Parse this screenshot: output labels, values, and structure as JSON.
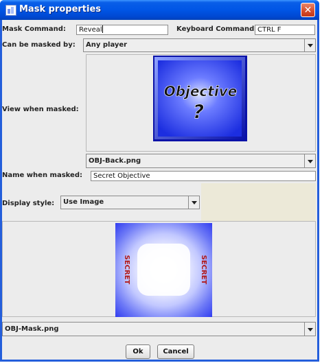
{
  "window": {
    "title": "Mask properties",
    "close_glyph": "✕"
  },
  "mask_command": {
    "label": "Mask Command:",
    "value": "Reveal"
  },
  "keyboard_command": {
    "label": "Keyboard Command:",
    "value": "CTRL F"
  },
  "can_be_masked_by": {
    "label": "Can be masked by:",
    "value": "Any player"
  },
  "view_when_masked": {
    "label": "View when masked:",
    "image": {
      "title": "Objective",
      "symbol": "?"
    },
    "file": "OBJ-Back.png"
  },
  "name_when_masked": {
    "label": "Name when masked:",
    "value": "Secret Objective"
  },
  "display_style": {
    "label": "Display style:",
    "value": "Use Image",
    "image": {
      "side_text": "SECRET"
    },
    "file": "OBJ-Mask.png"
  },
  "buttons": {
    "ok": "Ok",
    "cancel": "Cancel"
  },
  "colors": {
    "titlebar": "#0055e5",
    "objective_blue": "#1c2ee0",
    "mask_blue": "#3440f0",
    "disabled_area": "#ece9d8"
  }
}
